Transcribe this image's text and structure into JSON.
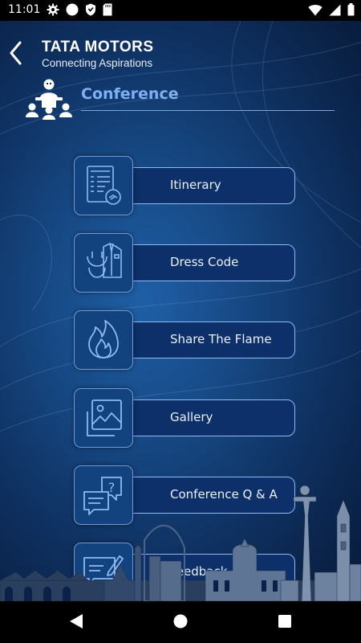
{
  "status_bar": {
    "time": "11:01",
    "left_icons": [
      "gear-icon",
      "circle-icon",
      "shield-icon",
      "sd-card-icon"
    ],
    "right_icons": [
      "wifi-icon",
      "signal-icon",
      "battery-icon"
    ]
  },
  "header": {
    "brand_main": "TATA",
    "brand_second": "MOTORS",
    "tagline": "Connecting Aspirations"
  },
  "section": {
    "title": "Conference"
  },
  "menu": [
    {
      "label": "Itinerary",
      "icon": "itinerary-icon"
    },
    {
      "label": "Dress Code",
      "icon": "dress-code-icon"
    },
    {
      "label": "Share The Flame",
      "icon": "flame-icon"
    },
    {
      "label": "Gallery",
      "icon": "gallery-icon"
    },
    {
      "label": "Conference Q & A",
      "icon": "qa-chat-icon"
    },
    {
      "label": "Feedback",
      "icon": "feedback-icon"
    }
  ],
  "colors": {
    "accent": "#7fb0f0",
    "tile_bg": "#12437f",
    "pill_bg": "#0d2f6a",
    "pill_border": "#8fbaf2"
  },
  "nav_bar": {
    "buttons": [
      "back-triangle-icon",
      "home-circle-icon",
      "recents-square-icon"
    ]
  }
}
